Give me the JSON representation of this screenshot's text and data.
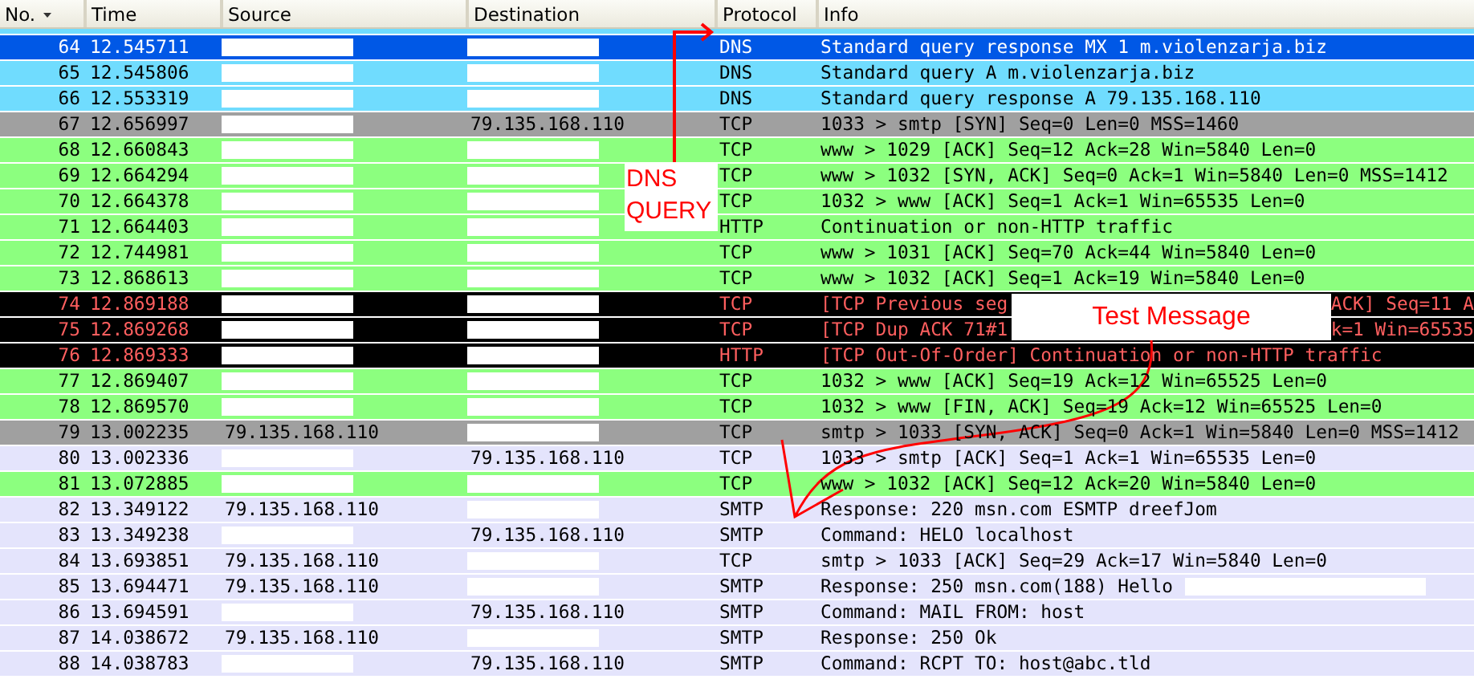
{
  "columns": [
    {
      "label": "No."
    },
    {
      "label": "Time"
    },
    {
      "label": "Source"
    },
    {
      "label": "Destination"
    },
    {
      "label": "Protocol"
    },
    {
      "label": "Info"
    }
  ],
  "rows": [
    {
      "no": "64",
      "time": "12.545711",
      "source_redacted": true,
      "destination_redacted": true,
      "protocol": "DNS",
      "info": "Standard query response MX 1 m.violenzarja.biz",
      "selected": true
    },
    {
      "no": "65",
      "time": "12.545806",
      "source_redacted": true,
      "destination_redacted": true,
      "protocol": "DNS",
      "info": "Standard query A m.violenzarja.biz",
      "kind": "dns",
      "selected": false
    },
    {
      "no": "66",
      "time": "12.553319",
      "source_redacted": true,
      "destination_redacted": true,
      "protocol": "DNS",
      "info": "Standard query response A 79.135.168.110",
      "kind": "dns",
      "selected": false
    },
    {
      "no": "67",
      "time": "12.656997",
      "source_redacted": true,
      "destination": "79.135.168.110",
      "protocol": "TCP",
      "info": "1033 > smtp [SYN] Seq=0 Len=0 MSS=1460",
      "kind": "syn",
      "selected": false
    },
    {
      "no": "68",
      "time": "12.660843",
      "source_redacted": true,
      "destination_redacted": true,
      "protocol": "TCP",
      "info": "www > 1029 [ACK] Seq=12 Ack=28 Win=5840 Len=0",
      "kind": "http",
      "selected": false
    },
    {
      "no": "69",
      "time": "12.664294",
      "source_redacted": true,
      "destination_redacted": true,
      "protocol": "TCP",
      "info": "www > 1032 [SYN, ACK] Seq=0 Ack=1 Win=5840 Len=0 MSS=1412",
      "kind": "http",
      "selected": false
    },
    {
      "no": "70",
      "time": "12.664378",
      "source_redacted": true,
      "destination_redacted": true,
      "protocol": "TCP",
      "info": "1032 > www [ACK] Seq=1 Ack=1 Win=65535 Len=0",
      "kind": "http",
      "selected": false
    },
    {
      "no": "71",
      "time": "12.664403",
      "source_redacted": true,
      "destination_redacted": true,
      "protocol": "HTTP",
      "info": "Continuation or non-HTTP traffic",
      "kind": "http",
      "selected": false
    },
    {
      "no": "72",
      "time": "12.744981",
      "source_redacted": true,
      "destination_redacted": true,
      "protocol": "TCP",
      "info": "www > 1031 [ACK] Seq=70 Ack=44 Win=5840 Len=0",
      "kind": "http",
      "selected": false
    },
    {
      "no": "73",
      "time": "12.868613",
      "source_redacted": true,
      "destination_redacted": true,
      "protocol": "TCP",
      "info": "www > 1032 [ACK] Seq=1 Ack=19 Win=5840 Len=0",
      "kind": "http",
      "selected": false
    },
    {
      "no": "74",
      "time": "12.869188",
      "source_redacted": true,
      "destination_redacted": true,
      "protocol": "TCP",
      "info": "[TCP Previous seg",
      "info_tail": "ACK] Seq=11 A",
      "kind": "bad",
      "selected": false
    },
    {
      "no": "75",
      "time": "12.869268",
      "source_redacted": true,
      "destination_redacted": true,
      "protocol": "TCP",
      "info": "[TCP Dup ACK 71#1",
      "info_tail": "k=1 Win=65535",
      "kind": "bad",
      "selected": false
    },
    {
      "no": "76",
      "time": "12.869333",
      "source_redacted": true,
      "destination_redacted": true,
      "protocol": "HTTP",
      "info": "[TCP Out-Of-Order] Continuation or non-HTTP traffic",
      "kind": "bad",
      "selected": false
    },
    {
      "no": "77",
      "time": "12.869407",
      "source_redacted": true,
      "destination_redacted": true,
      "protocol": "TCP",
      "info": "1032 > www [ACK] Seq=19 Ack=12 Win=65525 Len=0",
      "kind": "http",
      "selected": false
    },
    {
      "no": "78",
      "time": "12.869570",
      "source_redacted": true,
      "destination_redacted": true,
      "protocol": "TCP",
      "info": "1032 > www [FIN, ACK] Seq=19 Ack=12 Win=65525 Len=0",
      "kind": "http",
      "selected": false
    },
    {
      "no": "79",
      "time": "13.002235",
      "source": "79.135.168.110",
      "destination_redacted": true,
      "protocol": "TCP",
      "info": "smtp > 1033 [SYN, ACK] Seq=0 Ack=1 Win=5840 Len=0 MSS=1412",
      "kind": "syn",
      "selected": false
    },
    {
      "no": "80",
      "time": "13.002336",
      "source_redacted": true,
      "destination": "79.135.168.110",
      "protocol": "TCP",
      "info": "1033 > smtp [ACK] Seq=1 Ack=1 Win=65535 Len=0",
      "kind": "smtp",
      "selected": false
    },
    {
      "no": "81",
      "time": "13.072885",
      "source_redacted": true,
      "destination_redacted": true,
      "protocol": "TCP",
      "info": "www > 1032 [ACK] Seq=12 Ack=20 Win=5840 Len=0",
      "kind": "http",
      "selected": false
    },
    {
      "no": "82",
      "time": "13.349122",
      "source": "79.135.168.110",
      "destination_redacted": true,
      "protocol": "SMTP",
      "info": "Response: 220 msn.com ESMTP dreefJom",
      "kind": "smtp",
      "selected": false
    },
    {
      "no": "83",
      "time": "13.349238",
      "source_redacted": true,
      "destination": "79.135.168.110",
      "protocol": "SMTP",
      "info": "Command: HELO localhost",
      "kind": "smtp",
      "selected": false
    },
    {
      "no": "84",
      "time": "13.693851",
      "source": "79.135.168.110",
      "destination_redacted": true,
      "protocol": "TCP",
      "info": "smtp > 1033 [ACK] Seq=29 Ack=17 Win=5840 Len=0",
      "kind": "smtp",
      "selected": false
    },
    {
      "no": "85",
      "time": "13.694471",
      "source": "79.135.168.110",
      "destination_redacted": true,
      "protocol": "SMTP",
      "info": "Response: 250 msn.com(188) Hello",
      "info_redacted": true,
      "kind": "smtp",
      "selected": false
    },
    {
      "no": "86",
      "time": "13.694591",
      "source_redacted": true,
      "destination": "79.135.168.110",
      "protocol": "SMTP",
      "info": "Command: MAIL FROM: host",
      "kind": "smtp",
      "selected": false
    },
    {
      "no": "87",
      "time": "14.038672",
      "source": "79.135.168.110",
      "destination_redacted": true,
      "protocol": "SMTP",
      "info": "Response: 250 Ok",
      "kind": "smtp",
      "selected": false
    },
    {
      "no": "88",
      "time": "14.038783",
      "source_redacted": true,
      "destination": "79.135.168.110",
      "protocol": "SMTP",
      "info": "Command: RCPT TO: host@abc.tld",
      "kind": "smtp",
      "selected": false
    }
  ],
  "annotations": [
    {
      "kind": "elbow",
      "lines": [
        "DNS",
        "QUERY"
      ]
    },
    {
      "kind": "curve",
      "lines": [
        "Test Message"
      ]
    }
  ]
}
